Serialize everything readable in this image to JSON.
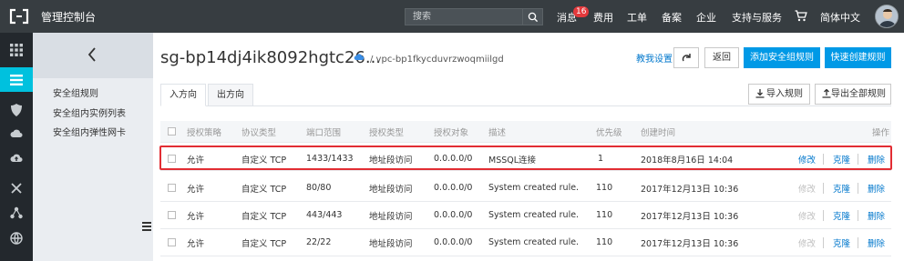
{
  "topbar": {
    "console_title": "管理控制台",
    "search_placeholder": "搜索",
    "messages_label": "消息",
    "messages_count": "16",
    "nav": [
      "费用",
      "工单",
      "备案",
      "企业",
      "支持与服务"
    ],
    "language": "简体中文"
  },
  "subnav": {
    "items": [
      "安全组规则",
      "安全组内实例列表",
      "安全组内弹性网卡"
    ]
  },
  "header": {
    "title": "sg-bp14dj4ik8092hgtc26...",
    "vpc": "/ vpc-bp1fkycduvrzwoqmiilgd",
    "tutorial": "教我设置",
    "back_label": "返回",
    "add_rule_label": "添加安全组规则",
    "quick_create_label": "快速创建规则"
  },
  "tabs": [
    "入方向",
    "出方向"
  ],
  "actions": {
    "import_label": "导入规则",
    "export_label": "导出全部规则"
  },
  "table": {
    "columns": [
      "授权策略",
      "协议类型",
      "端口范围",
      "授权类型",
      "授权对象",
      "描述",
      "优先级",
      "创建时间",
      "操作"
    ],
    "rows": [
      {
        "policy": "允许",
        "protocol": "自定义 TCP",
        "port": "1433/1433",
        "auth_type": "地址段访问",
        "auth_object": "0.0.0.0/0",
        "desc": "MSSQL连接",
        "priority": "1",
        "created": "2018年8月16日 14:04",
        "edit": "修改",
        "clone": "克隆",
        "delete": "删除",
        "edit_disabled": false
      },
      {
        "policy": "允许",
        "protocol": "自定义 TCP",
        "port": "80/80",
        "auth_type": "地址段访问",
        "auth_object": "0.0.0.0/0",
        "desc": "System created rule.",
        "priority": "110",
        "created": "2017年12月13日 10:36",
        "edit": "修改",
        "clone": "克隆",
        "delete": "删除",
        "edit_disabled": true
      },
      {
        "policy": "允许",
        "protocol": "自定义 TCP",
        "port": "443/443",
        "auth_type": "地址段访问",
        "auth_object": "0.0.0.0/0",
        "desc": "System created rule.",
        "priority": "110",
        "created": "2017年12月13日 10:36",
        "edit": "修改",
        "clone": "克隆",
        "delete": "删除",
        "edit_disabled": true
      },
      {
        "policy": "允许",
        "protocol": "自定义 TCP",
        "port": "22/22",
        "auth_type": "地址段访问",
        "auth_object": "0.0.0.0/0",
        "desc": "System created rule.",
        "priority": "110",
        "created": "2017年12月13日 10:36",
        "edit": "修改",
        "clone": "克隆",
        "delete": "删除",
        "edit_disabled": true
      }
    ]
  },
  "colors": {
    "topbar": "#373d41",
    "iconbar": "#23282d",
    "accent": "#00c1de",
    "primary_button": "#0099e6",
    "link": "#0077cc",
    "highlight": "#e22d33"
  },
  "icons": {
    "logo": "aliyun-logo",
    "iconbar": [
      "grid-icon",
      "list-icon",
      "shield-icon",
      "cloud-icon",
      "cloud-upload-icon",
      "shuffle-icon",
      "network-icon",
      "globe-icon"
    ]
  }
}
